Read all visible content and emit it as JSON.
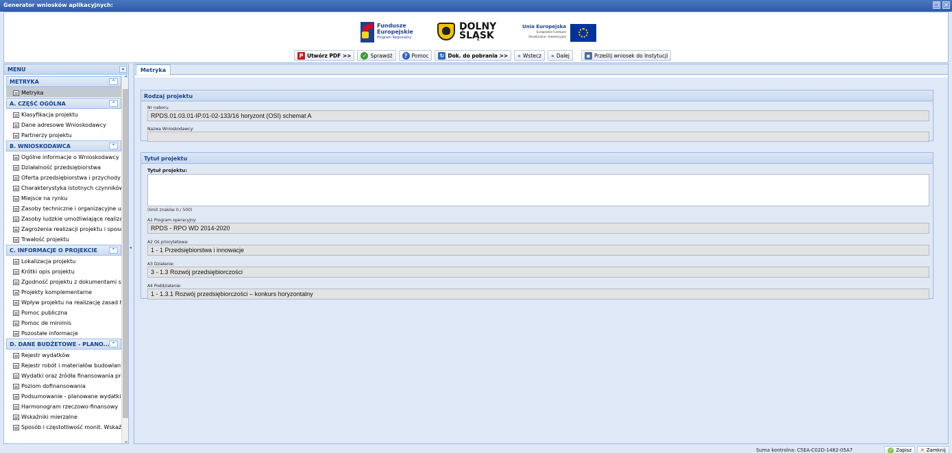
{
  "window": {
    "title": "Generator wniosków aplikacyjnych:",
    "restore_glyph": "❐",
    "close_glyph": "✕"
  },
  "logos": {
    "fe_line1": "Fundusze",
    "fe_line2": "Europejskie",
    "fe_sub": "Program Regionalny",
    "ds_line1": "DOLNY",
    "ds_line2": "ŚLĄSK",
    "ue_line1": "Unia Europejska",
    "ue_sub1": "Europejskie Fundusze",
    "ue_sub2": "Strukturalne i Inwestycyjne"
  },
  "toolbar": {
    "pdf": "Utwórz PDF >>",
    "check": "Sprawdź",
    "help": "Pomoc",
    "download": "Dok. do pobrania >>",
    "back": "Wstecz",
    "next": "Dalej",
    "send": "Prześlij wniosek do Instytucji"
  },
  "menu": {
    "title": "MENU",
    "sections": [
      {
        "label": "METRYKA",
        "items": [
          "Metryka"
        ]
      },
      {
        "label": "A. CZĘŚĆ OGÓLNA",
        "items": [
          "Klasyfikacja projektu",
          "Dane adresowe Wnioskodawcy",
          "Partnerzy projektu"
        ]
      },
      {
        "label": "B. WNIOSKODAWCA",
        "items": [
          "Ogólne informacje o Wnioskodawcy",
          "Działalność przedsiębiorstwa",
          "Oferta przedsiębiorstwa i przychody z",
          "Charakterystyka istotnych czynników k",
          "Miejsce na rynku",
          "Zasoby techniczne i organizacyjne umo",
          "Zasoby ludzkie umożliwiające realizacj",
          "Zagrożenia realizacji projektu i sposob",
          "Trwałość projektu"
        ]
      },
      {
        "label": "C. INFORMACJE O PROJEKCIE",
        "items": [
          "Lokalizacja projektu",
          "Krótki opis projektu",
          "Zgodność projektu z dokumentami stra",
          "Projekty komplementarne",
          "Wpływ projektu na realizację zasad ho",
          "Pomoc publiczna",
          "Pomoc de minimis",
          "Pozostałe informacje"
        ]
      },
      {
        "label": "D. DANE BUDŻETOWE - PLANO...",
        "items": [
          "Rejestr wydatków",
          "Rejestr robót i materiałów budowlanyc",
          "Wydatki oraz źródła finansowania proj",
          "Poziom dofinansowania",
          "Podsumowanie - planowane wydatki w",
          "Harmonogram rzeczowo-finansowy",
          "Wskaźniki mierzalne",
          "Sposób i częstotliwość monit. Wskaźni"
        ]
      }
    ]
  },
  "main": {
    "tab": "Metryka",
    "panel1": {
      "title": "Rodzaj projektu",
      "nr_label": "Nr naboru:",
      "nr_value": "RPDS.01.03.01-IP.01-02-133/16 horyzont (OSI) schemat A",
      "name_label": "Nazwa Wnioskodawcy:",
      "name_value": ""
    },
    "panel2": {
      "title": "Tytuł projektu",
      "title_label": "Tytuł projektu:",
      "title_value": "",
      "limit": "(limit znaków 0 / 500)",
      "a1_label": "A1 Program operacyjny:",
      "a1_value": "RPDS - RPO WD 2014-2020",
      "a2_label": "A2 Oś priorytetowa:",
      "a2_value": "1 - 1 Przedsiębiorstwa i innowacje",
      "a3_label": "A3 Działanie:",
      "a3_value": "3 - 1.3 Rozwój przedsiębiorczości",
      "a4_label": "A4 Poddziałanie:",
      "a4_value": "1 - 1.3.1 Rozwój przedsiębiorczości – konkurs horyzontalny"
    }
  },
  "status": {
    "checksum": "Suma kontrolna: C5EA-C02D-1482-05A7",
    "save": "Zapisz",
    "close": "Zamknij"
  }
}
